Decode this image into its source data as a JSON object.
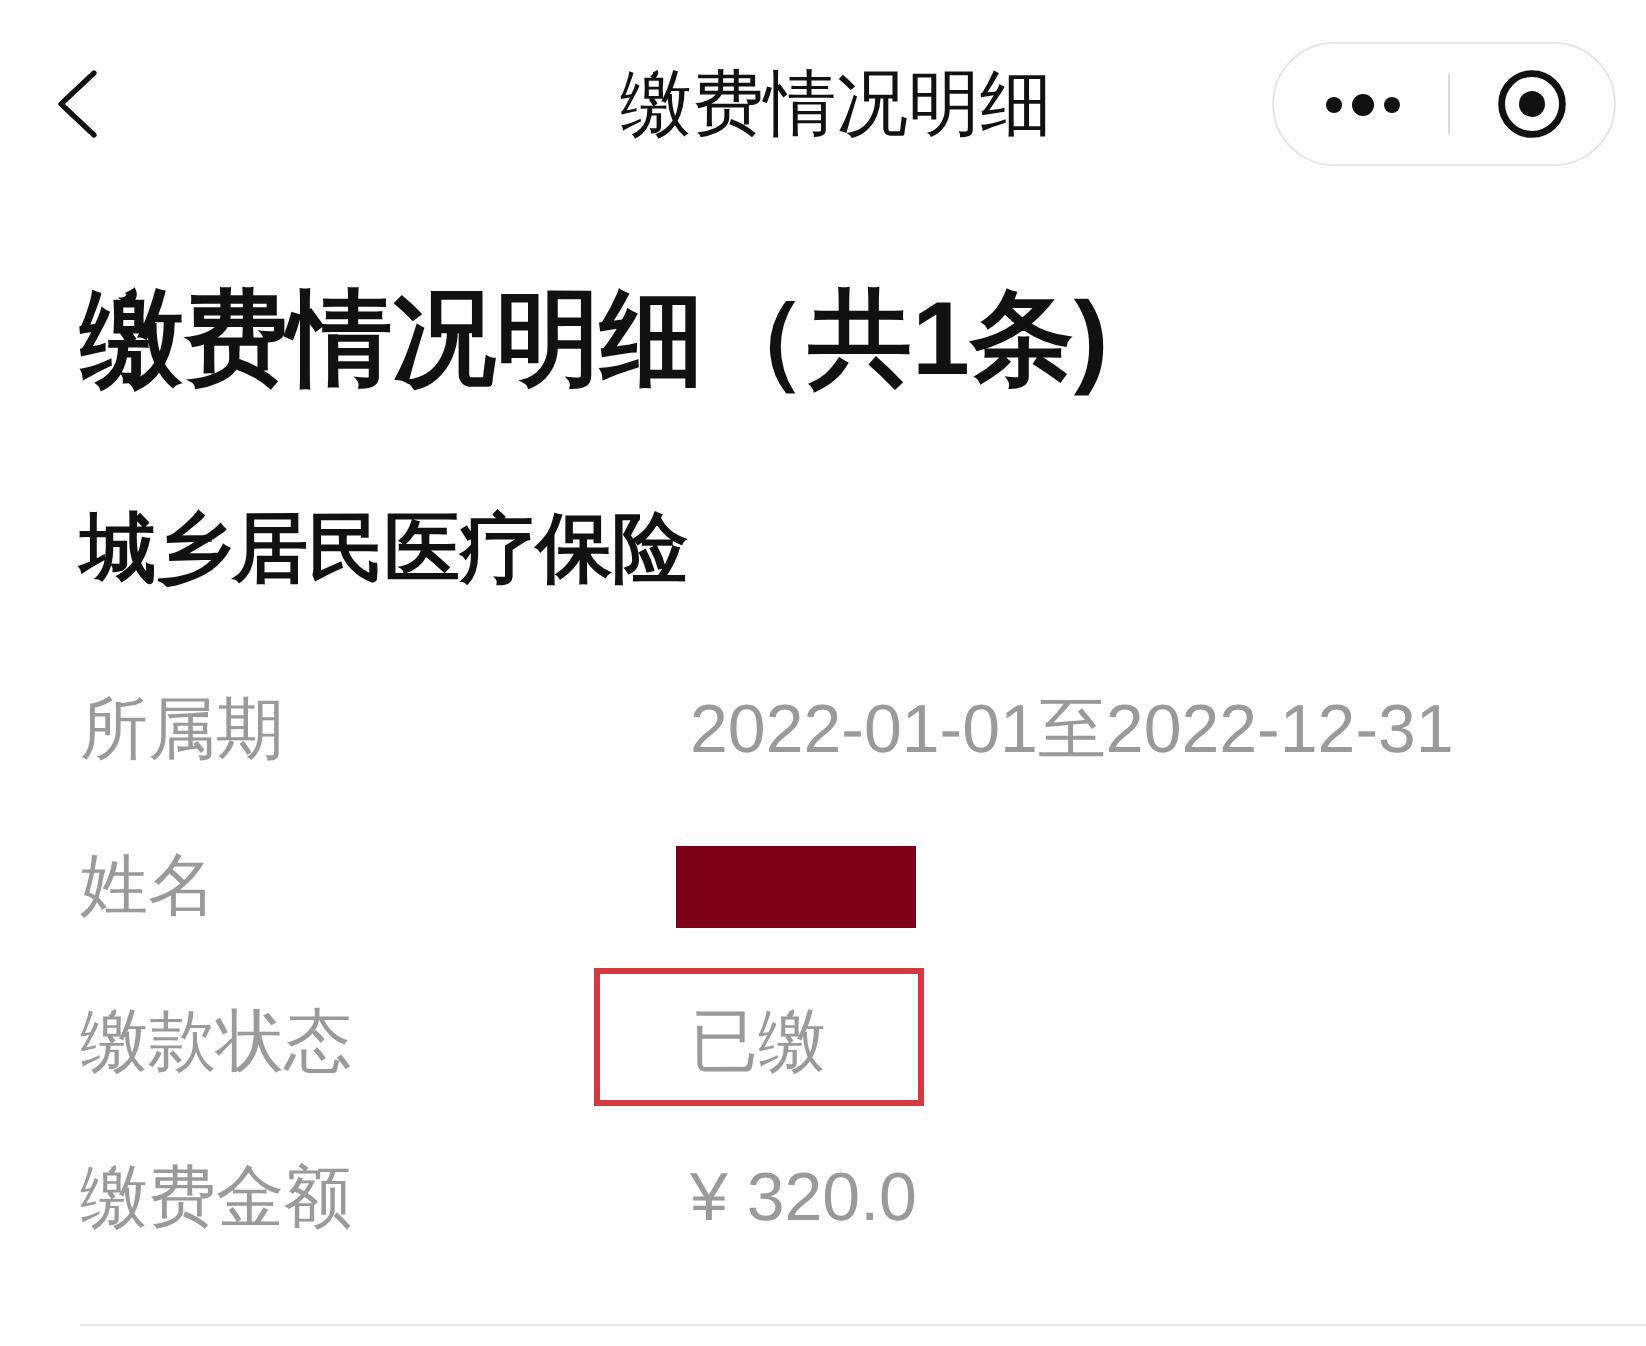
{
  "nav_bar": {
    "title": "缴费情况明细"
  },
  "page_title": "缴费情况明细（共1条)",
  "section": {
    "title": "城乡居民医疗保险",
    "rows": [
      {
        "label": "所属期",
        "kind": "text",
        "value": "2022-01-01至2022-12-31",
        "highlighted": false
      },
      {
        "label": "姓名",
        "kind": "redacted",
        "highlighted": false
      },
      {
        "label": "缴款状态",
        "kind": "text",
        "value": "已缴",
        "highlighted": true
      },
      {
        "label": "缴费金额",
        "kind": "text",
        "value": "¥ 320.0",
        "highlighted": false
      }
    ]
  }
}
